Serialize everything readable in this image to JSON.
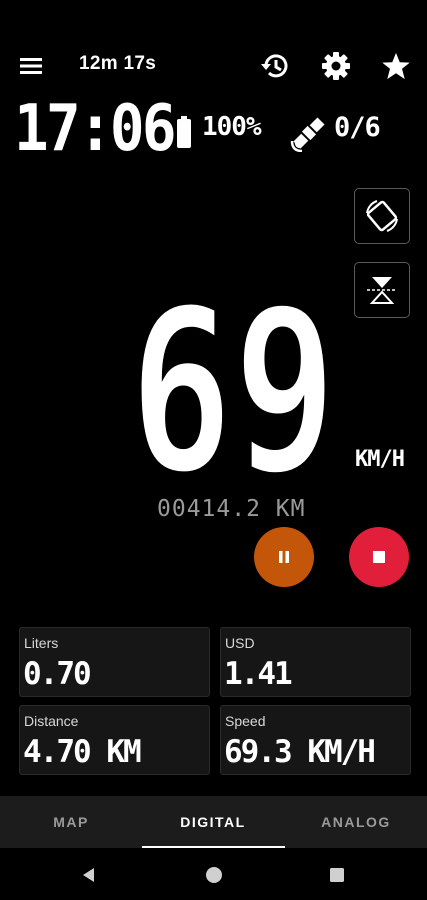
{
  "toolbar": {
    "elapsed": "12m 17s",
    "icons": [
      "menu-icon",
      "history-icon",
      "settings-icon",
      "star-icon"
    ]
  },
  "status": {
    "clock": "17:06",
    "battery": "100%",
    "satellites": "0/6"
  },
  "gauge": {
    "speed": "69",
    "unit": "KM/H",
    "odometer": "00414.2 KM"
  },
  "controls": {
    "pause_color": "#c4560a",
    "stop_color": "#e21f3a"
  },
  "stats": [
    {
      "label": "Liters",
      "value": "0.70"
    },
    {
      "label": "USD",
      "value": "1.41"
    },
    {
      "label": "Distance",
      "value": "4.70 KM"
    },
    {
      "label": "Speed",
      "value": "69.3 KM/H"
    }
  ],
  "tabs": [
    {
      "label": "MAP"
    },
    {
      "label": "DIGITAL"
    },
    {
      "label": "ANALOG"
    }
  ],
  "active_tab": "DIGITAL"
}
